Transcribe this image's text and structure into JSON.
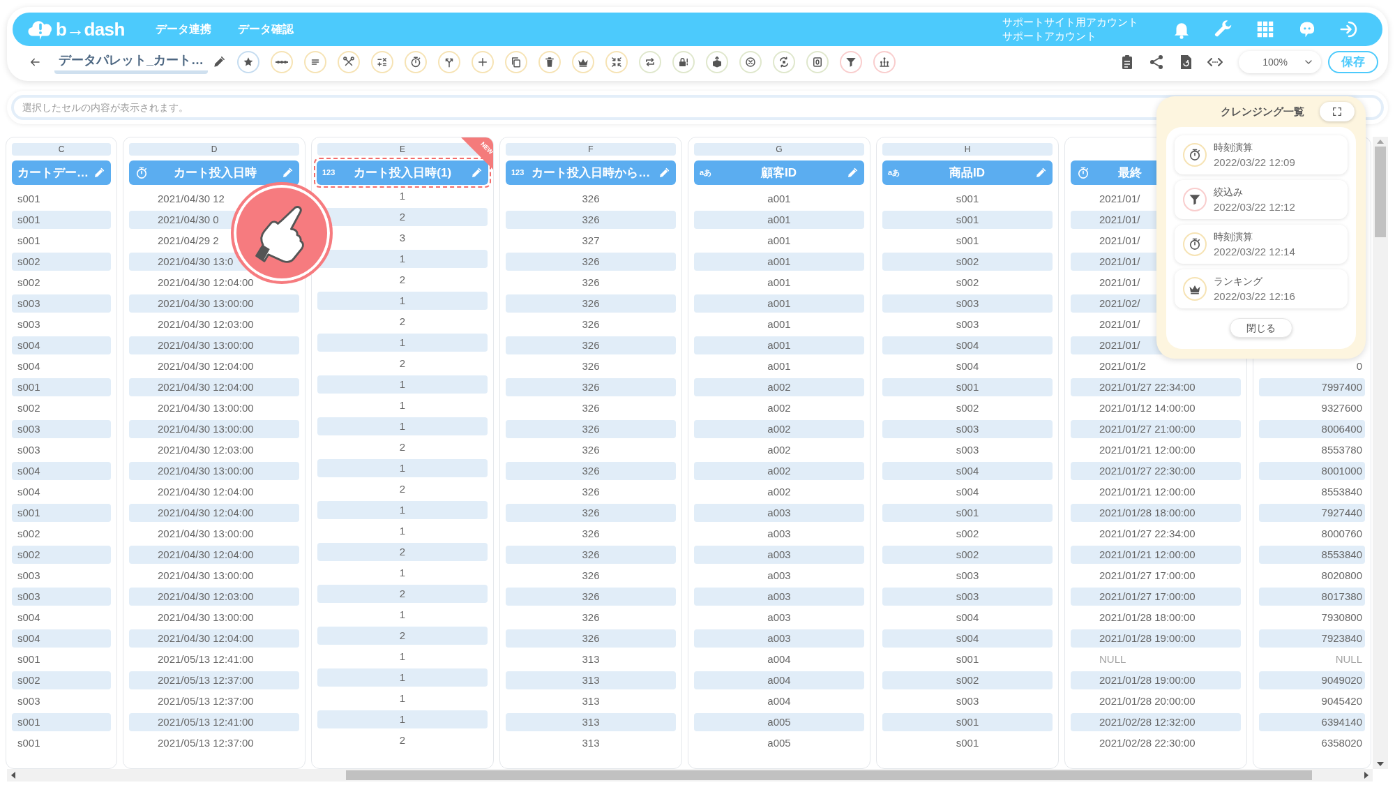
{
  "header": {
    "logo": "b→dash",
    "nav": [
      {
        "label": "データ連携"
      },
      {
        "label": "データ確認"
      }
    ],
    "account": [
      "サポートサイト用アカウント",
      "サポートアカウント"
    ]
  },
  "toolbar": {
    "title": "データパレット_カート…",
    "zoom": "100%",
    "save_button": "保存",
    "buttons": [
      {
        "kind": "star",
        "color": "#c5dcf0"
      },
      {
        "kind": "dots",
        "color": "#f6e3b4"
      },
      {
        "kind": "lines",
        "color": "#f6e3b4"
      },
      {
        "kind": "tools",
        "color": "#f6e3b4"
      },
      {
        "kind": "calc",
        "color": "#f6e3b4"
      },
      {
        "kind": "stopwatch",
        "color": "#f6e3b4"
      },
      {
        "kind": "branch",
        "color": "#f6e3b4"
      },
      {
        "kind": "plus",
        "color": "#f6e3b4"
      },
      {
        "kind": "copy",
        "color": "#f6e3b4"
      },
      {
        "kind": "trash",
        "color": "#f6e3b4"
      },
      {
        "kind": "crown",
        "color": "#f6e3b4"
      },
      {
        "kind": "compress",
        "color": "#f6e3b4"
      },
      {
        "kind": "repeat",
        "color": "#dfe7cc"
      },
      {
        "kind": "lock",
        "color": "#dfe7cc"
      },
      {
        "kind": "box",
        "color": "#dfe7cc"
      },
      {
        "kind": "cancel",
        "color": "#dfe7cc"
      },
      {
        "kind": "swap",
        "color": "#dfe7cc"
      },
      {
        "kind": "zero",
        "color": "#dfe7cc"
      },
      {
        "kind": "filter",
        "color": "#f9cdcd"
      },
      {
        "kind": "group",
        "color": "#f9cdcd"
      }
    ]
  },
  "cell_field": {
    "placeholder": "選択したセルの内容が表示されます。"
  },
  "columns": [
    {
      "letter": "C",
      "title": "カートデー…",
      "highlighted": false,
      "cells": [
        "s001",
        "s001",
        "s001",
        "s002",
        "s002",
        "s003",
        "s003",
        "s004",
        "s004",
        "s001",
        "s002",
        "s003",
        "s003",
        "s004",
        "s004",
        "s001",
        "s002",
        "s002",
        "s003",
        "s003",
        "s004",
        "s004",
        "s001",
        "s002",
        "s003",
        "s001",
        "s001"
      ]
    },
    {
      "letter": "D",
      "title": "カート投入日時",
      "kind": "time",
      "highlighted": false,
      "cells": [
        "2021/04/30 12",
        "2021/04/30 0",
        "2021/04/29 2",
        "2021/04/30 13:0",
        "2021/04/30 12:04:00",
        "2021/04/30 13:00:00",
        "2021/04/30 12:03:00",
        "2021/04/30 13:00:00",
        "2021/04/30 12:04:00",
        "2021/04/30 12:04:00",
        "2021/04/30 13:00:00",
        "2021/04/30 13:00:00",
        "2021/04/30 12:03:00",
        "2021/04/30 13:00:00",
        "2021/04/30 12:04:00",
        "2021/04/30 12:04:00",
        "2021/04/30 13:00:00",
        "2021/04/30 12:04:00",
        "2021/04/30 13:00:00",
        "2021/04/30 12:03:00",
        "2021/04/30 13:00:00",
        "2021/04/30 12:04:00",
        "2021/05/13 12:41:00",
        "2021/05/13 12:37:00",
        "2021/05/13 12:37:00",
        "2021/05/13 12:41:00",
        "2021/05/13 12:37:00"
      ]
    },
    {
      "letter": "E",
      "title": "カート投入日時(1)",
      "kind": "number",
      "type_label": "123",
      "highlighted": true,
      "badge": "NEW",
      "cells": [
        "1",
        "2",
        "3",
        "1",
        "2",
        "1",
        "2",
        "1",
        "2",
        "1",
        "1",
        "1",
        "2",
        "1",
        "2",
        "1",
        "1",
        "2",
        "1",
        "2",
        "1",
        "2",
        "1",
        "1",
        "1",
        "1",
        "2"
      ]
    },
    {
      "letter": "F",
      "title": "カート投入日時から…",
      "kind": "number",
      "type_label": "123",
      "highlighted": false,
      "cells": [
        "326",
        "326",
        "327",
        "326",
        "326",
        "326",
        "326",
        "326",
        "326",
        "326",
        "326",
        "326",
        "326",
        "326",
        "326",
        "326",
        "326",
        "326",
        "326",
        "326",
        "326",
        "326",
        "313",
        "313",
        "313",
        "313",
        "313"
      ]
    },
    {
      "letter": "G",
      "title": "顧客ID",
      "kind": "text",
      "type_label": "aあ",
      "highlighted": false,
      "cells": [
        "a001",
        "a001",
        "a001",
        "a001",
        "a001",
        "a001",
        "a001",
        "a001",
        "a001",
        "a002",
        "a002",
        "a002",
        "a002",
        "a002",
        "a002",
        "a003",
        "a003",
        "a003",
        "a003",
        "a003",
        "a003",
        "a003",
        "a004",
        "a004",
        "a004",
        "a005",
        "a005"
      ]
    },
    {
      "letter": "H",
      "title": "商品ID",
      "kind": "text",
      "type_label": "aあ",
      "highlighted": false,
      "cells": [
        "s001",
        "s001",
        "s001",
        "s002",
        "s002",
        "s003",
        "s003",
        "s004",
        "s004",
        "s001",
        "s002",
        "s003",
        "s003",
        "s004",
        "s004",
        "s001",
        "s002",
        "s002",
        "s003",
        "s003",
        "s004",
        "s004",
        "s001",
        "s002",
        "s003",
        "s001",
        "s001"
      ]
    },
    {
      "title": "最終",
      "kind": "time",
      "highlighted": false,
      "cells": [
        "2021/01/",
        "2021/01/",
        "2021/01/",
        "2021/01/",
        "2021/01/",
        "2021/02/",
        "2021/01/",
        "2021/01/",
        "2021/01/2",
        "2021/01/27 22:34:00",
        "2021/01/12 14:00:00",
        "2021/01/27 21:00:00",
        "2021/01/21 12:00:00",
        "2021/01/27 22:30:00",
        "2021/01/21 12:00:00",
        "2021/01/28 18:00:00",
        "2021/01/27 22:34:00",
        "2021/01/21 12:00:00",
        "2021/01/27 17:00:00",
        "2021/01/27 17:00:00",
        "2021/01/28 18:00:00",
        "2021/01/28 19:00:00",
        {
          "text": "NULL",
          "kind": "null"
        },
        "2021/01/28 19:00:00",
        "2021/01/28 20:00:00",
        "2021/02/28 12:32:00",
        "2021/02/28 22:30:00"
      ]
    },
    {
      "highlighted": false,
      "cells": [
        null,
        null,
        null,
        null,
        null,
        null,
        null,
        null,
        "0",
        "7997400",
        "9327600",
        "8006400",
        "8553780",
        "8001000",
        "8553840",
        "7927440",
        "8000760",
        "8553840",
        "8020800",
        "8017380",
        "7930800",
        "7923840",
        {
          "text": "NULL",
          "kind": "null"
        },
        "9049020",
        "9045420",
        "6394140",
        "6358020"
      ]
    }
  ],
  "cleansing_panel": {
    "title": "クレンジング一覧",
    "close_button": "閉じる",
    "items": [
      {
        "kind": "stopwatch",
        "color": "#f6e3b4",
        "name": "時刻演算",
        "time": "2022/03/22 12:09"
      },
      {
        "kind": "filter",
        "color": "#f9cdcd",
        "name": "絞込み",
        "time": "2022/03/22 12:12"
      },
      {
        "kind": "stopwatch",
        "color": "#f6e3b4",
        "name": "時刻演算",
        "time": "2022/03/22 12:14"
      },
      {
        "kind": "crown",
        "color": "#f6e3b4",
        "name": "ランキング",
        "time": "2022/03/22 12:16"
      }
    ]
  }
}
